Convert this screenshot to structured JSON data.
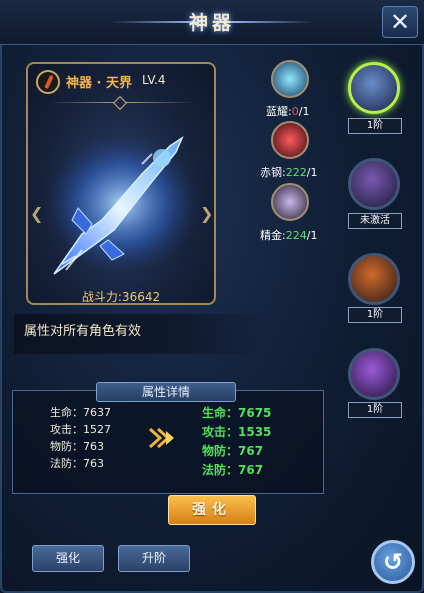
{
  "title": "神器",
  "close_icon": "close-x",
  "weapon": {
    "name": "神器 · 天界",
    "level": "LV.4",
    "power": "战斗力:36642"
  },
  "effect_text": "属性对所有角色有效",
  "materials": [
    {
      "name": "蓝耀",
      "current": "0",
      "sep": "/",
      "need": "1",
      "color": "#6fd0ff"
    },
    {
      "name": "赤钢",
      "current": "222",
      "sep": "/",
      "need": "1",
      "color": "#e0303a"
    },
    {
      "name": "精金",
      "current": "224",
      "sep": "/",
      "need": "1",
      "color": "#b0a0d0"
    }
  ],
  "slots": [
    {
      "tag": "1阶",
      "state": "active"
    },
    {
      "tag": "未激活",
      "state": "inactive"
    },
    {
      "tag": "1阶",
      "state": "normal"
    },
    {
      "tag": "1阶",
      "state": "normal"
    }
  ],
  "attributes": {
    "header": "属性详情",
    "current": [
      "生命：7637",
      "攻击：1527",
      "物防：763",
      "法防：763"
    ],
    "next": [
      "生命：7675",
      "攻击：1535",
      "物防：767",
      "法防：767"
    ]
  },
  "buttons": {
    "enhance": "强化",
    "tab_enhance": "强化",
    "tab_upgrade": "升阶",
    "back_icon": "undo-arrow"
  }
}
